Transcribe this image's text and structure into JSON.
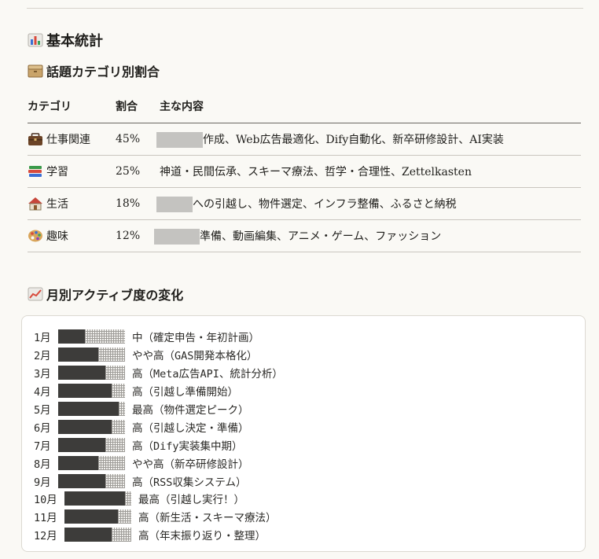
{
  "section_title": "基本統計",
  "category_section": {
    "title": "話題カテゴリ別割合",
    "headers": [
      "カテゴリ",
      "割合",
      "主な内容"
    ],
    "rows": [
      {
        "icon": "briefcase-icon",
        "category": "仕事関連",
        "ratio": "45%",
        "content": "作成、Web広告最適化、Dify自動化、新卒研修設計、AI実装"
      },
      {
        "icon": "books-icon",
        "category": "学習",
        "ratio": "25%",
        "content": "神道・民間伝承、スキーマ療法、哲学・合理性、Zettelkasten"
      },
      {
        "icon": "house-icon",
        "category": "生活",
        "ratio": "18%",
        "content": "への引越し、物件選定、インフラ整備、ふるさと納税"
      },
      {
        "icon": "palette-icon",
        "category": "趣味",
        "ratio": "12%",
        "content": "準備、動画編集、アニメ・ゲーム、ファッション"
      }
    ]
  },
  "monthly_section": {
    "title": "月別アクティブ度の変化",
    "months": [
      {
        "month": "1月",
        "level": 4,
        "label": "中（確定申告・年初計画）"
      },
      {
        "month": "2月",
        "level": 6,
        "label": "やや高（GAS開発本格化）"
      },
      {
        "month": "3月",
        "level": 7,
        "label": "高（Meta広告API、統計分析）"
      },
      {
        "month": "4月",
        "level": 8,
        "label": "高（引越し準備開始）"
      },
      {
        "month": "5月",
        "level": 9,
        "label": "最高（物件選定ピーク）"
      },
      {
        "month": "6月",
        "level": 8,
        "label": "高（引越し決定・準備）"
      },
      {
        "month": "7月",
        "level": 7,
        "label": "高（Dify実装集中期）"
      },
      {
        "month": "8月",
        "level": 6,
        "label": "やや高（新卒研修設計）"
      },
      {
        "month": "9月",
        "level": 7,
        "label": "高（RSS収集システム）"
      },
      {
        "month": "10月",
        "level": 9,
        "label": "最高（引越し実行！）"
      },
      {
        "month": "11月",
        "level": 8,
        "label": "高（新生活・スキーマ療法）"
      },
      {
        "month": "12月",
        "level": 7,
        "label": "高（年末振り返り・整理）"
      }
    ],
    "bar_total": 10
  }
}
